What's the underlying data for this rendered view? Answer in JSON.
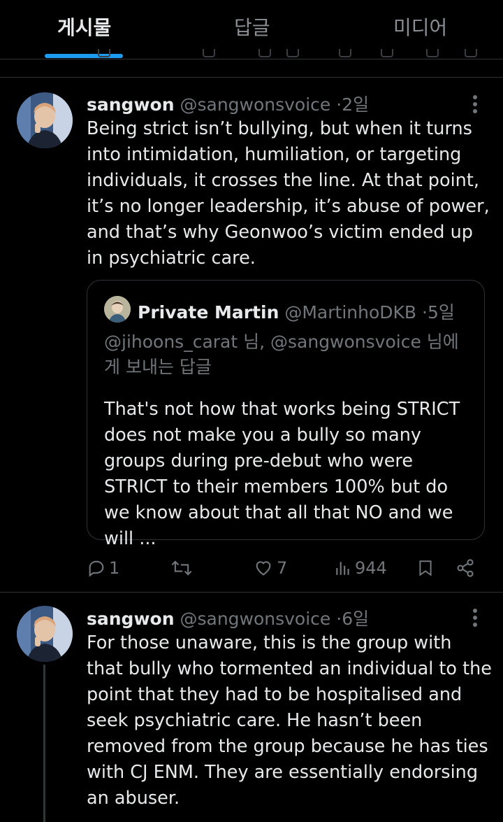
{
  "tabs": [
    {
      "label": "게시물",
      "active": true
    },
    {
      "label": "답글",
      "active": false
    },
    {
      "label": "미디어",
      "active": false
    }
  ],
  "colors": {
    "accent": "#1d9bf0",
    "background": "#000000",
    "text": "#e7e9ea",
    "muted": "#71767b",
    "divider": "#2f3336"
  },
  "post1": {
    "name": "sangwon",
    "handle": "@sangwonsvoice",
    "dot": "·",
    "time": "2일",
    "text": "Being strict isn’t bullying, but when it turns into intimidation, humiliation, or targeting individuals, it crosses the line. At that point, it’s no longer leadership, it’s abuse of power, and that’s why Geonwoo’s victim ended up in psychiatric care.",
    "quote": {
      "name": "Private Martin",
      "handle": "@MartinhoDKB",
      "dot": "·",
      "time": "5일",
      "reply_to": "@jihoons_carat 님, @sangwonsvoice 님에게 보내는 답글",
      "text": "That's not how that works being STRICT does not make you a bully so many groups during pre-debut who were STRICT to their members 100% but do we know about that all that NO and we will ..."
    },
    "actions": {
      "replies": "1",
      "reposts": "",
      "likes": "7",
      "views": "944"
    }
  },
  "post2": {
    "name": "sangwon",
    "handle": "@sangwonsvoice",
    "dot": "·",
    "time": "6일",
    "text": "For those unaware, this is the group with that bully who tormented an individual to the point that they had to be hospitalised and seek psychiatric care. He hasn’t been removed from the group because he has ties with CJ ENM. They are essentially endorsing an abuser."
  },
  "icons": [
    "more-icon",
    "reply-icon",
    "repost-icon",
    "like-icon",
    "views-icon",
    "bookmark-icon",
    "share-icon"
  ]
}
